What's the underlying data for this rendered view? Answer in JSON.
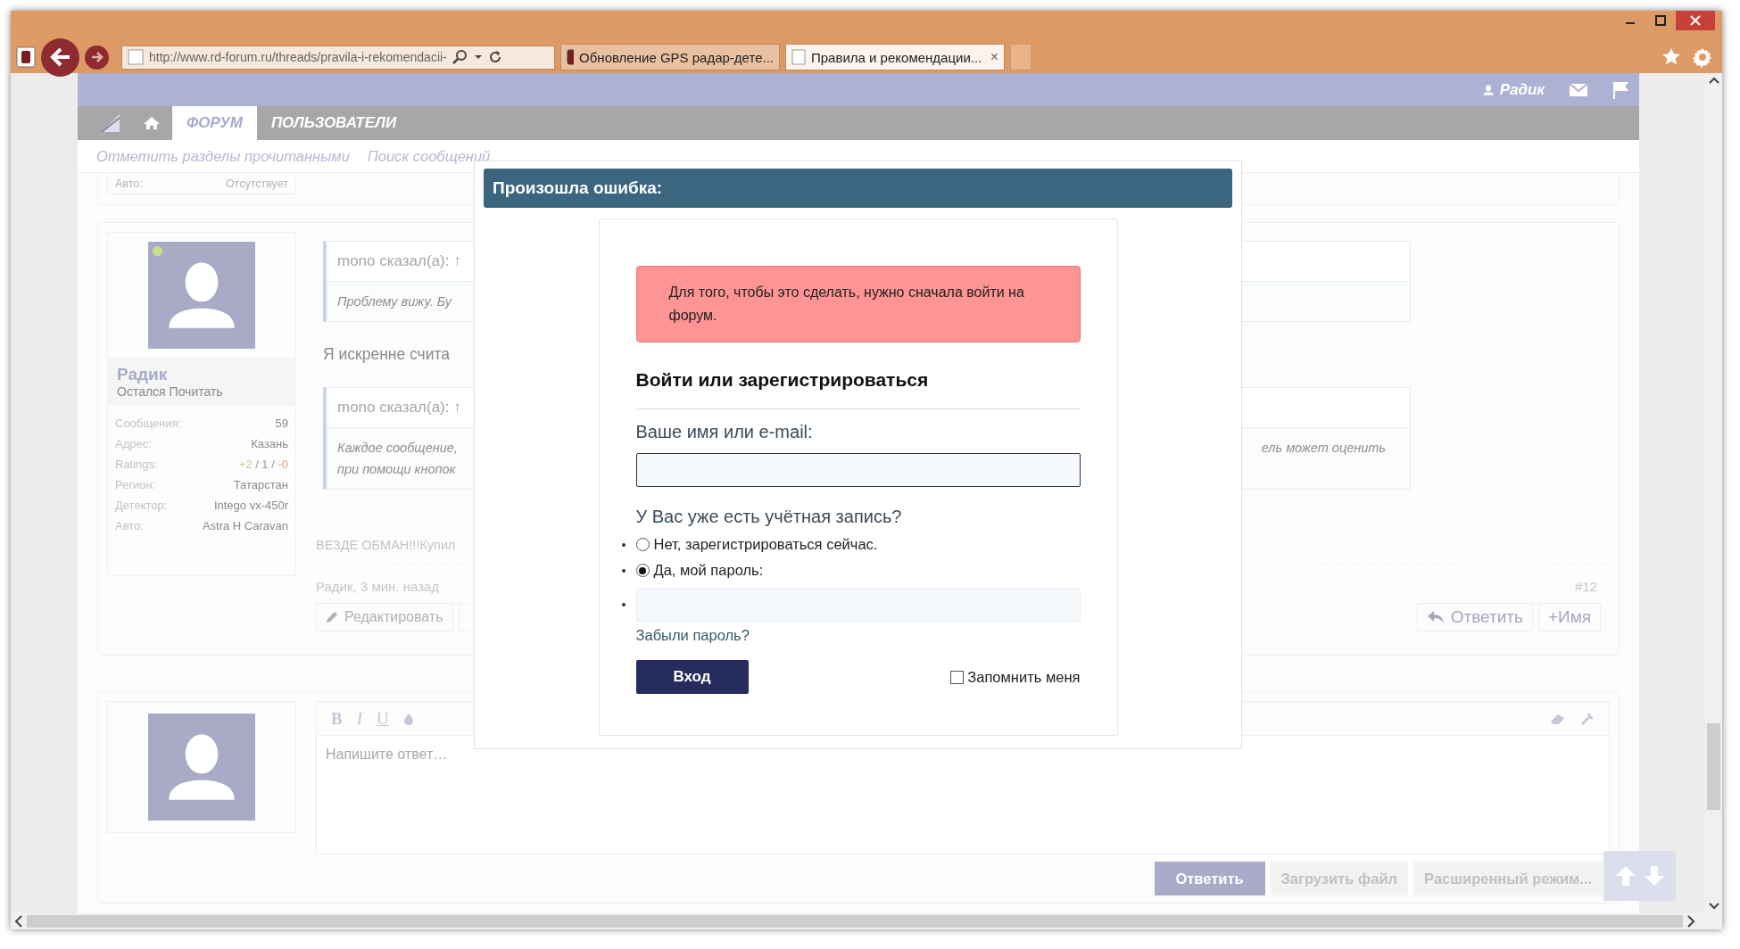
{
  "browser": {
    "address": "http://www.rd-forum.ru/threads/pravila-i-rekomendacii-",
    "tabs": [
      {
        "title": "Обновление GPS радар-дете...",
        "selected": false
      },
      {
        "title": "Правила и рекомендации...",
        "selected": true
      }
    ],
    "tab_close": "×"
  },
  "header": {
    "user": "Радик"
  },
  "nav": {
    "tabs": [
      {
        "label": "ФОРУМ",
        "selected": true
      },
      {
        "label": "ПОЛЬЗОВАТЕЛИ",
        "selected": false
      }
    ],
    "links": [
      "Отметить разделы прочитанными",
      "Поиск сообщений"
    ]
  },
  "previous_post": {
    "label": "Авто:",
    "value": "Отсутствует"
  },
  "post": {
    "author": "Радик",
    "user_title": "Остался Почитать",
    "online": true,
    "stats": [
      {
        "kind": "text",
        "label": "Сообщения:",
        "value": "59"
      },
      {
        "kind": "text",
        "label": "Адрес:",
        "value": "Казань"
      },
      {
        "kind": "ratings",
        "label": "Ratings:",
        "parts": [
          {
            "text": "+2",
            "color": "#b9cf8c"
          },
          {
            "text": " / 1 / ",
            "color": "#9a9a9a"
          },
          {
            "text": "-0",
            "color": "#e8a08c"
          }
        ]
      },
      {
        "kind": "text",
        "label": "Регион:",
        "value": "Татарстан"
      },
      {
        "kind": "text",
        "label": "Детектор:",
        "value": "Intego vx-450r"
      },
      {
        "kind": "text",
        "label": "Авто:",
        "value": "Astra H Caravan"
      }
    ],
    "quotes": [
      {
        "author": "mono сказал(а): ↑",
        "lines": [
          "Проблему вижу. Бу"
        ]
      },
      {
        "author": "mono сказал(а): ↑",
        "lines": [
          "Каждое сообщение,",
          "при помощи кнопок"
        ],
        "right_text": "ель может оценить"
      }
    ],
    "body": "Я искренне счита",
    "signature": "ВЕЗДЕ ОБМАН!!!Купил",
    "meta": "Радик, 3 мин. назад",
    "number": "#12",
    "left_actions": [
      "Редактировать"
    ],
    "right_actions": [
      "Ответить",
      "+Имя"
    ]
  },
  "editor": {
    "toolbar": [
      "B",
      "I",
      "U"
    ],
    "placeholder": "Напишите ответ…",
    "buttons": [
      {
        "label": "Ответить",
        "kind": "primary"
      },
      {
        "label": "Загрузить файл",
        "kind": "secondary"
      },
      {
        "label": "Расширенный режим...",
        "kind": "secondary"
      }
    ]
  },
  "modal": {
    "title": "Произошла ошибка:",
    "error": "Для того, чтобы это сделать, нужно сначала войти на форум.",
    "heading": "Войти или зарегистрироваться",
    "name_label": "Ваше имя или e-mail:",
    "question": "У Вас уже есть учётная запись?",
    "options": [
      {
        "label": "Нет, зарегистрироваться сейчас.",
        "selected": false
      },
      {
        "label": "Да, мой пароль:",
        "selected": true
      }
    ],
    "forgot": "Забыли пароль?",
    "submit": "Вход",
    "remember": {
      "label": "Запомнить меня",
      "checked": false
    }
  }
}
